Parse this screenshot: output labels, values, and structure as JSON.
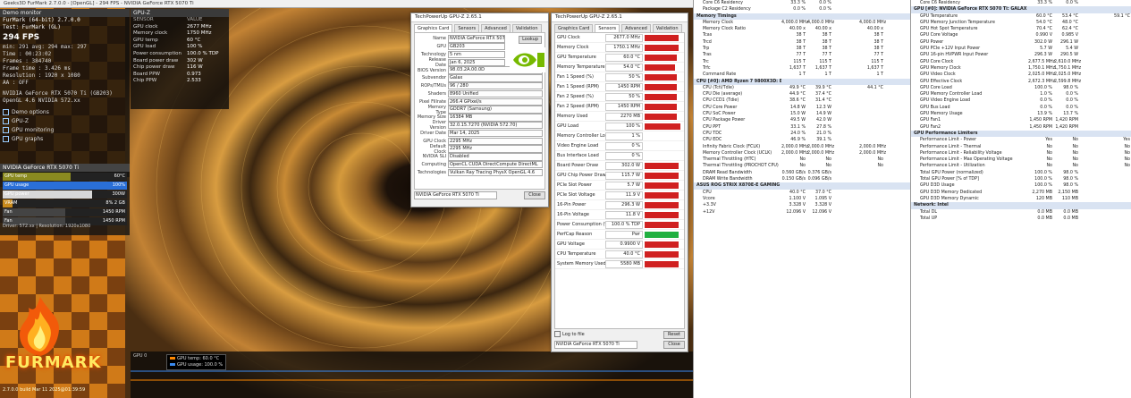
{
  "furmark": {
    "window_title": "Geeks3D FurMark 2.7.0.0 - [OpenGL] - 294 FPS - NVIDIA GeForce RTX 5070 Ti",
    "panel_title": "Demo monitor",
    "line1": "FurMark (64-bit) 2.7.0.0",
    "line2": "Test: FurMark (GL)",
    "fps": "294 FPS",
    "stats": [
      "min: 291  avg: 294  max: 297",
      "Time        : 00:23:02",
      "Frames      : 384740",
      "Frame time  : 3.426 ms",
      "Resolution  : 1920 x 1080",
      "AA          : OFF"
    ],
    "gpu_line": "NVIDIA GeForce RTX 5070 Ti (GB203)",
    "driver_line": "OpenGL 4.6 NVIDIA 572.xx",
    "options": [
      "Demo options",
      "GPU-Z",
      "GPU monitoring",
      "GPU graphs"
    ],
    "gpu_panel_title": "NVIDIA GeForce RTX 5070 Ti",
    "bars": [
      {
        "label": "GPU temp",
        "value": "60°C",
        "level": 0.55,
        "color": "#8a8a20"
      },
      {
        "label": "GPU usage",
        "value": "100%",
        "level": 1.0,
        "color": "#2a6fd8"
      },
      {
        "label": "GPU power",
        "value": "300W",
        "level": 0.72,
        "color": "#d8d8d8"
      },
      {
        "label": "VRAM",
        "value": "8% 2 GB",
        "level": 0.08,
        "color": "#c98a1c"
      },
      {
        "label": "Fan",
        "value": "1450 RPM",
        "level": 0.5,
        "color": "#444"
      },
      {
        "label": "Fan",
        "value": "1450 RPM",
        "level": 0.5,
        "color": "#444"
      }
    ],
    "footer_lines": [
      "Driver: 572.xx  |  Resolution: 1920x1080"
    ],
    "logo_text": "FURMARK",
    "version": "2.7.0.0 build Mar 11 2025@01:39:59",
    "graph_legend": [
      "GPU temp: 60.0 °C",
      "GPU usage: 100.0 %"
    ],
    "graph_label": "GPU 0"
  },
  "gpuz_overlay": {
    "title": "GPU-Z",
    "header": [
      "SENSOR",
      "VALUE"
    ],
    "rows": [
      [
        "GPU clock",
        "2677 MHz"
      ],
      [
        "Memory clock",
        "1750 MHz"
      ],
      [
        "GPU temp",
        "60 °C"
      ],
      [
        "GPU load",
        "100 %"
      ],
      [
        "Power consumption",
        "100.0 % TDP"
      ],
      [
        "Board power draw",
        "302 W"
      ],
      [
        "Chip power draw",
        "116 W"
      ],
      [
        "Board PPW",
        "0.973"
      ],
      [
        "Chip PPW",
        "2.533"
      ]
    ]
  },
  "gpuz": {
    "title": "TechPowerUp GPU-Z 2.65.1",
    "tabs": [
      "Graphics Card",
      "Sensors",
      "Advanced",
      "Validation"
    ],
    "fields": [
      [
        "Name",
        "NVIDIA GeForce RTX 5070 Ti"
      ],
      [
        "GPU",
        "GB203"
      ],
      [
        "Technology",
        "5 nm"
      ],
      [
        "Release Date",
        "Jan 6, 2025"
      ],
      [
        "BIOS Version",
        "98.03.2A.00.0D"
      ],
      [
        "Subvendor",
        "Galax"
      ],
      [
        "ROPs/TMUs",
        "96 / 280"
      ],
      [
        "Shaders",
        "8960 Unified"
      ],
      [
        "Pixel Fillrate",
        "266.4 GPixel/s"
      ],
      [
        "Memory Type",
        "GDDR7 (Samsung)"
      ],
      [
        "Memory Size",
        "16384 MB"
      ],
      [
        "Driver Version",
        "32.0.15.7270 (NVIDIA 572.70)"
      ],
      [
        "Driver Date",
        "Mar 14, 2025"
      ],
      [
        "GPU Clock",
        "2295 MHz"
      ],
      [
        "Default Clock",
        "2295 MHz"
      ],
      [
        "NVIDIA SLI",
        "Disabled"
      ],
      [
        "Computing",
        "OpenCL  CUDA  DirectCompute  DirectML"
      ],
      [
        "Technologies",
        "Vulkan  Ray Tracing  PhysX  OpenGL 4.6"
      ]
    ],
    "lookup_label": "Lookup",
    "card_select": "NVIDIA GeForce RTX 5070 Ti",
    "close_label": "Close"
  },
  "sensors": {
    "title": "TechPowerUp GPU-Z 2.65.1",
    "tabs": [
      "Graphics Card",
      "Sensors",
      "Advanced",
      "Validation"
    ],
    "rows": [
      [
        "GPU Clock",
        "2677.0 MHz",
        0.9
      ],
      [
        "Memory Clock",
        "1750.1 MHz",
        0.9
      ],
      [
        "GPU Temperature",
        "60.0 °C",
        0.85
      ],
      [
        "Memory Temperature",
        "54.0 °C",
        0.8
      ],
      [
        "Fan 1 Speed (%)",
        "50 %",
        0.85
      ],
      [
        "Fan 1 Speed (RPM)",
        "1450 RPM",
        0.85
      ],
      [
        "Fan 2 Speed (%)",
        "50 %",
        0.85
      ],
      [
        "Fan 2 Speed (RPM)",
        "1450 RPM",
        0.85
      ],
      [
        "Memory Used",
        "2270 MB",
        0.85
      ],
      [
        "GPU Load",
        "100 %",
        0.95
      ],
      [
        "Memory Controller Load",
        "1 %",
        0.0
      ],
      [
        "Video Engine Load",
        "0 %",
        0.0
      ],
      [
        "Bus Interface Load",
        "0 %",
        0.0
      ],
      [
        "Board Power Draw",
        "302.0 W",
        0.9
      ],
      [
        "GPU Chip Power Draw",
        "115.7 W",
        0.9
      ],
      [
        "PCIe Slot Power",
        "5.7 W",
        0.9
      ],
      [
        "PCIe Slot Voltage",
        "11.9 V",
        0.9
      ],
      [
        "16-Pin Power",
        "296.3 W",
        0.9
      ],
      [
        "16-Pin Voltage",
        "11.8 V",
        0.9
      ],
      [
        "Power Consumption (%)",
        "100.0 % TDP",
        0.9
      ],
      [
        "PerfCap Reason",
        "Pwr",
        0.9
      ],
      [
        "GPU Voltage",
        "0.9900 V",
        0.9
      ],
      [
        "CPU Temperature",
        "40.0 °C",
        0.9
      ],
      [
        "System Memory Used",
        "5580 MB",
        0.9
      ]
    ],
    "log_label": "Log to file",
    "reset_label": "Reset",
    "card_select": "NVIDIA GeForce RTX 5070 Ti",
    "close_label": "Close"
  },
  "hwinfo_left": {
    "rows": [
      [
        "Core C6 Residency",
        "33.3 %",
        "0.0 %",
        "",
        "",
        ""
      ],
      [
        "Package C2 Residency",
        "0.0 %",
        "0.0 %",
        "",
        "",
        ""
      ],
      [
        "Memory Timings",
        "",
        "",
        "",
        "",
        ""
      ],
      [
        "Memory Clock",
        "4,000.0 MHz",
        "4,000.0 MHz",
        "",
        "4,000.0 MHz",
        ""
      ],
      [
        "Memory Clock Ratio",
        "40.00 x",
        "40.00 x",
        "",
        "40.00 x",
        ""
      ],
      [
        "Tcas",
        "38 T",
        "38 T",
        "",
        "38 T",
        ""
      ],
      [
        "Trcd",
        "38 T",
        "38 T",
        "",
        "38 T",
        ""
      ],
      [
        "Trp",
        "38 T",
        "38 T",
        "",
        "38 T",
        ""
      ],
      [
        "Tras",
        "77 T",
        "77 T",
        "",
        "77 T",
        ""
      ],
      [
        "Trc",
        "115 T",
        "115 T",
        "",
        "115 T",
        ""
      ],
      [
        "Trfc",
        "1,637 T",
        "1,637 T",
        "",
        "1,637 T",
        ""
      ],
      [
        "Command Rate",
        "1 T",
        "1 T",
        "",
        "1 T",
        ""
      ],
      [
        "CPU [#0]: AMD Ryzen 7 9800X3D: Enhanced",
        "",
        "",
        "",
        "",
        ""
      ],
      [
        "CPU (Tctl/Tdie)",
        "49.9 °C",
        "39.9 °C",
        "",
        "44.1 °C",
        ""
      ],
      [
        "CPU Die (average)",
        "44.9 °C",
        "37.4 °C",
        "",
        "",
        ""
      ],
      [
        "CPU CCD1 (Tdie)",
        "38.6 °C",
        "31.4 °C",
        "",
        "",
        ""
      ],
      [
        "CPU Core Power",
        "14.8 W",
        "12.3 W",
        "",
        "",
        ""
      ],
      [
        "CPU SoC Power",
        "15.0 W",
        "14.9 W",
        "",
        "",
        ""
      ],
      [
        "CPU Package Power",
        "49.5 W",
        "42.0 W",
        "",
        "",
        ""
      ],
      [
        "CPU PPT",
        "33.1 %",
        "27.8 %",
        "",
        "",
        ""
      ],
      [
        "CPU TDC",
        "24.0 %",
        "21.0 %",
        "",
        "",
        ""
      ],
      [
        "CPU EDC",
        "46.9 %",
        "39.1 %",
        "",
        "",
        ""
      ],
      [
        "Infinity Fabric Clock (FCLK)",
        "2,000.0 MHz",
        "2,000.0 MHz",
        "",
        "2,000.0 MHz",
        ""
      ],
      [
        "Memory Controller Clock (UCLK)",
        "2,000.0 MHz",
        "2,000.0 MHz",
        "",
        "2,000.0 MHz",
        ""
      ],
      [
        "Thermal Throttling (HTC)",
        "No",
        "No",
        "",
        "No",
        ""
      ],
      [
        "Thermal Throttling (PROCHOT CPU)",
        "No",
        "No",
        "",
        "No",
        ""
      ],
      [
        "DRAM Read Bandwidth",
        "0.560 GB/s",
        "0.376 GB/s",
        "",
        "",
        ""
      ],
      [
        "DRAM Write Bandwidth",
        "0.150 GB/s",
        "0.096 GB/s",
        "",
        "",
        ""
      ],
      [
        "ASUS ROG STRIX X870E-E GAMING WIFI (Nuvoton)",
        "",
        "",
        "",
        "",
        ""
      ],
      [
        "CPU",
        "40.0 °C",
        "37.0 °C",
        "",
        "",
        ""
      ],
      [
        "Vcore",
        "1.100 V",
        "1.095 V",
        "",
        "",
        ""
      ],
      [
        "+3.3V",
        "3.328 V",
        "3.328 V",
        "",
        "",
        ""
      ],
      [
        "+12V",
        "12.096 V",
        "12.096 V",
        "",
        "",
        ""
      ]
    ]
  },
  "hwinfo_right": {
    "rows": [
      [
        "Core C6 Residency",
        "33.3 %",
        "0.0 %",
        "",
        ""
      ],
      [
        "GPU [#0]: NVIDIA GeForce RTX 5070 Ti: GALAX GeForce RTX 5070 Ti",
        "",
        "",
        "",
        ""
      ],
      [
        "GPU Temperature",
        "60.0 °C",
        "53.4 °C",
        "",
        "59.1 °C"
      ],
      [
        "GPU Memory Junction Temperature",
        "54.0 °C",
        "48.0 °C",
        "",
        ""
      ],
      [
        "GPU Hot Spot Temperature",
        "70.4 °C",
        "62.4 °C",
        "",
        ""
      ],
      [
        "GPU Core Voltage",
        "0.990 V",
        "0.985 V",
        "",
        ""
      ],
      [
        "GPU Power",
        "302.0 W",
        "296.1 W",
        "",
        ""
      ],
      [
        "GPU PCIe +12V Input Power",
        "5.7 W",
        "5.4 W",
        "",
        ""
      ],
      [
        "GPU 16-pin HVPWR Input Power",
        "296.3 W",
        "290.5 W",
        "",
        ""
      ],
      [
        "GPU Core Clock",
        "2,677.5 MHz",
        "2,610.0 MHz",
        "",
        ""
      ],
      [
        "GPU Memory Clock",
        "1,750.1 MHz",
        "1,750.1 MHz",
        "",
        ""
      ],
      [
        "GPU Video Clock",
        "2,025.0 MHz",
        "2,025.0 MHz",
        "",
        ""
      ],
      [
        "GPU Effective Clock",
        "2,672.3 MHz",
        "2,599.8 MHz",
        "",
        ""
      ],
      [
        "GPU Core Load",
        "100.0 %",
        "98.0 %",
        "",
        ""
      ],
      [
        "GPU Memory Controller Load",
        "1.0 %",
        "0.0 %",
        "",
        ""
      ],
      [
        "GPU Video Engine Load",
        "0.0 %",
        "0.0 %",
        "",
        ""
      ],
      [
        "GPU Bus Load",
        "0.0 %",
        "0.0 %",
        "",
        ""
      ],
      [
        "GPU Memory Usage",
        "13.9 %",
        "13.7 %",
        "",
        ""
      ],
      [
        "GPU Fan1",
        "1,450 RPM",
        "1,420 RPM",
        "",
        ""
      ],
      [
        "GPU Fan2",
        "1,450 RPM",
        "1,420 RPM",
        "",
        ""
      ],
      [
        "GPU Performance Limiters",
        "",
        "",
        "",
        ""
      ],
      [
        "Performance Limit - Power",
        "Yes",
        "No",
        "",
        "Yes"
      ],
      [
        "Performance Limit - Thermal",
        "No",
        "No",
        "",
        "No"
      ],
      [
        "Performance Limit - Reliability Voltage",
        "No",
        "No",
        "",
        "No"
      ],
      [
        "Performance Limit - Max Operating Voltage",
        "No",
        "No",
        "",
        "No"
      ],
      [
        "Performance Limit - Utilization",
        "No",
        "No",
        "",
        "No"
      ],
      [
        "Total GPU Power (normalized)",
        "100.0 %",
        "98.0 %",
        "",
        ""
      ],
      [
        "Total GPU Power [% of TDP]",
        "100.0 %",
        "98.0 %",
        "",
        ""
      ],
      [
        "GPU D3D Usage",
        "100.0 %",
        "98.0 %",
        "",
        ""
      ],
      [
        "GPU D3D Memory Dedicated",
        "2,270 MB",
        "2,150 MB",
        "",
        ""
      ],
      [
        "GPU D3D Memory Dynamic",
        "120 MB",
        "110 MB",
        "",
        ""
      ],
      [
        "Network: Intel",
        "",
        "",
        "",
        ""
      ],
      [
        "Total DL",
        "0.0 MB",
        "0.0 MB",
        "",
        ""
      ],
      [
        "Total UP",
        "0.0 MB",
        "0.0 MB",
        "",
        ""
      ]
    ]
  }
}
